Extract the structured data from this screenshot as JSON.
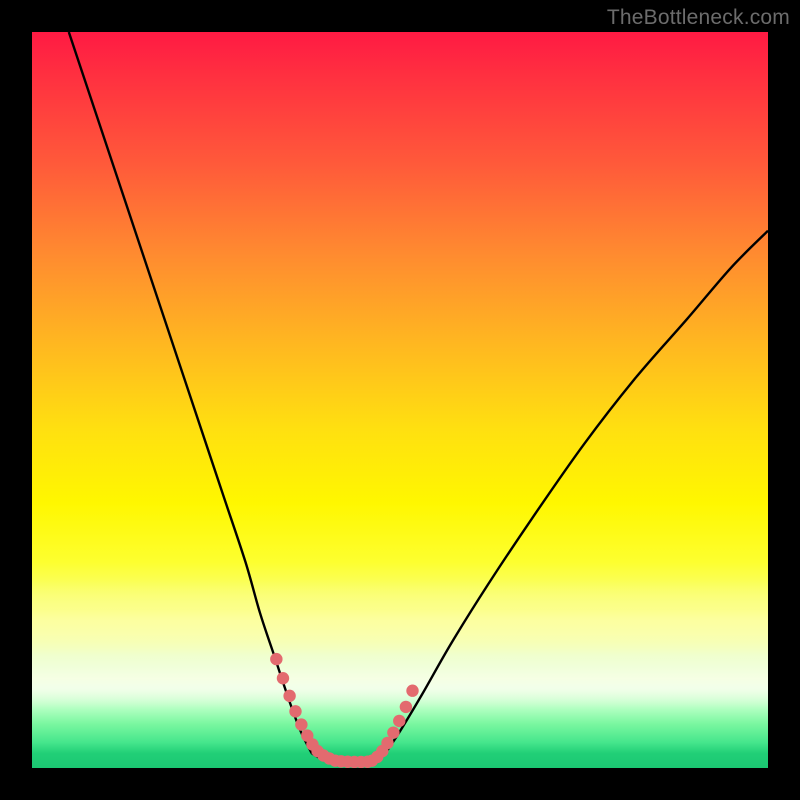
{
  "watermark": "TheBottleneck.com",
  "chart_data": {
    "type": "line",
    "title": "",
    "xlabel": "",
    "ylabel": "",
    "xlim": [
      0,
      100
    ],
    "ylim": [
      0,
      100
    ],
    "grid": false,
    "legend": false,
    "series": [
      {
        "name": "left-branch",
        "x": [
          5,
          8,
          11,
          14,
          17,
          20,
          23,
          26,
          29,
          31,
          33,
          35,
          36.5,
          38
        ],
        "y": [
          100,
          91,
          82,
          73,
          64,
          55,
          46,
          37,
          28,
          21,
          15,
          9,
          5,
          2
        ],
        "stroke": "#000000"
      },
      {
        "name": "right-branch",
        "x": [
          48,
          50,
          53,
          57,
          62,
          68,
          75,
          82,
          89,
          95,
          100
        ],
        "y": [
          2,
          5,
          10,
          17,
          25,
          34,
          44,
          53,
          61,
          68,
          73
        ],
        "stroke": "#000000"
      },
      {
        "name": "valley-floor",
        "x": [
          38,
          40,
          43,
          46,
          48
        ],
        "y": [
          2,
          1,
          0.8,
          1,
          2
        ],
        "stroke": "#000000"
      },
      {
        "name": "highlight-left-dots",
        "x": [
          33.2,
          34.1,
          35.0,
          35.8,
          36.6,
          37.4,
          38.1,
          38.8,
          39.6,
          40.4,
          41.2,
          42.0,
          42.9,
          43.8,
          44.7,
          45.6
        ],
        "y": [
          14.8,
          12.2,
          9.8,
          7.7,
          5.9,
          4.4,
          3.2,
          2.3,
          1.7,
          1.3,
          1.0,
          0.9,
          0.85,
          0.82,
          0.82,
          0.85
        ],
        "stroke": "#e36a6f",
        "marker": "dot"
      },
      {
        "name": "highlight-right-dots",
        "x": [
          46.2,
          46.9,
          47.6,
          48.3,
          49.1,
          49.9,
          50.8,
          51.7
        ],
        "y": [
          1.0,
          1.5,
          2.3,
          3.4,
          4.8,
          6.4,
          8.3,
          10.5
        ],
        "stroke": "#e36a6f",
        "marker": "dot"
      }
    ],
    "background_gradient": {
      "direction": "top-to-bottom",
      "stops": [
        {
          "pct": 0,
          "color": "#ff1a43"
        },
        {
          "pct": 18,
          "color": "#ff5a3a"
        },
        {
          "pct": 42,
          "color": "#ffb621"
        },
        {
          "pct": 64,
          "color": "#fff700"
        },
        {
          "pct": 85,
          "color": "#f0ffd0"
        },
        {
          "pct": 96,
          "color": "#46e68c"
        },
        {
          "pct": 100,
          "color": "#1bc772"
        }
      ]
    }
  }
}
